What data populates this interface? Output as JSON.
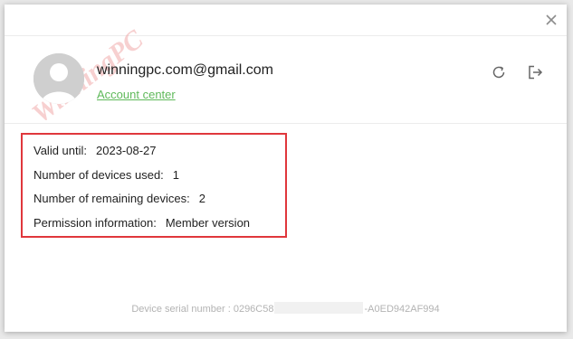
{
  "watermark": {
    "text": "WinningPC"
  },
  "account": {
    "email": "winningpc.com@gmail.com",
    "link_label": "Account center"
  },
  "info": {
    "valid_until_label": "Valid until:",
    "valid_until_value": "2023-08-27",
    "devices_used_label": "Number of devices used:",
    "devices_used_value": "1",
    "remaining_label": "Number of remaining devices:",
    "remaining_value": "2",
    "permission_label": "Permission information:",
    "permission_value": "Member version"
  },
  "serial": {
    "prefix": "Device serial number : 0296C58",
    "suffix": "-A0ED942AF994"
  },
  "colors": {
    "highlight_border": "#e0373c",
    "link": "#5fb95a",
    "watermark": "#f0a9a9"
  },
  "icons": {
    "close": "close-icon",
    "refresh": "refresh-icon",
    "logout": "logout-icon",
    "avatar": "avatar-icon"
  }
}
